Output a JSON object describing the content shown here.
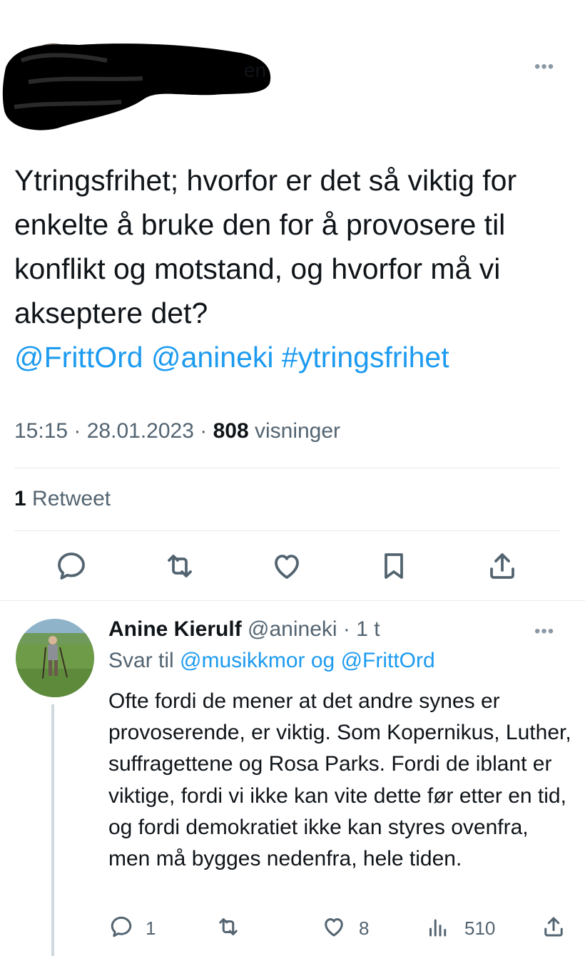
{
  "tweet": {
    "author_visible_fragment": "en",
    "text": "Ytringsfrihet; hvorfor er det så viktig for enkelte å bruke den for å provosere til konflikt og motstand, og hvorfor må vi akseptere det?",
    "links": "@FrittOrd @anineki #ytringsfrihet",
    "time": "15:15",
    "date": "28.01.2023",
    "views_count": "808",
    "views_label": "visninger",
    "retweet_count": "1",
    "retweet_label": "Retweet"
  },
  "reply": {
    "name": "Anine Kierulf",
    "handle": "@anineki",
    "age": "1 t",
    "reply_to_prefix": "Svar til",
    "reply_to_user1": "@musikkmor",
    "reply_to_conj": "og",
    "reply_to_user2": "@FrittOrd",
    "text": "Ofte fordi de mener at det andre synes er provoserende, er viktig. Som Kopernikus, Luther, suffragettene og Rosa Parks. Fordi de iblant er viktige, fordi vi ikke kan vite dette før etter en tid, og fordi demokratiet ikke kan styres ovenfra, men må bygges nedenfra, hele tiden.",
    "reply_count": "1",
    "like_count": "8",
    "view_count": "510"
  },
  "icons": {
    "more": "more-icon",
    "reply": "reply-icon",
    "retweet": "retweet-icon",
    "like": "like-icon",
    "bookmark": "bookmark-icon",
    "share": "share-icon",
    "views": "views-icon"
  },
  "colors": {
    "link": "#1d9bf0",
    "secondary_text": "#536471",
    "icon": "#536471",
    "divider": "#e6e9ec"
  }
}
